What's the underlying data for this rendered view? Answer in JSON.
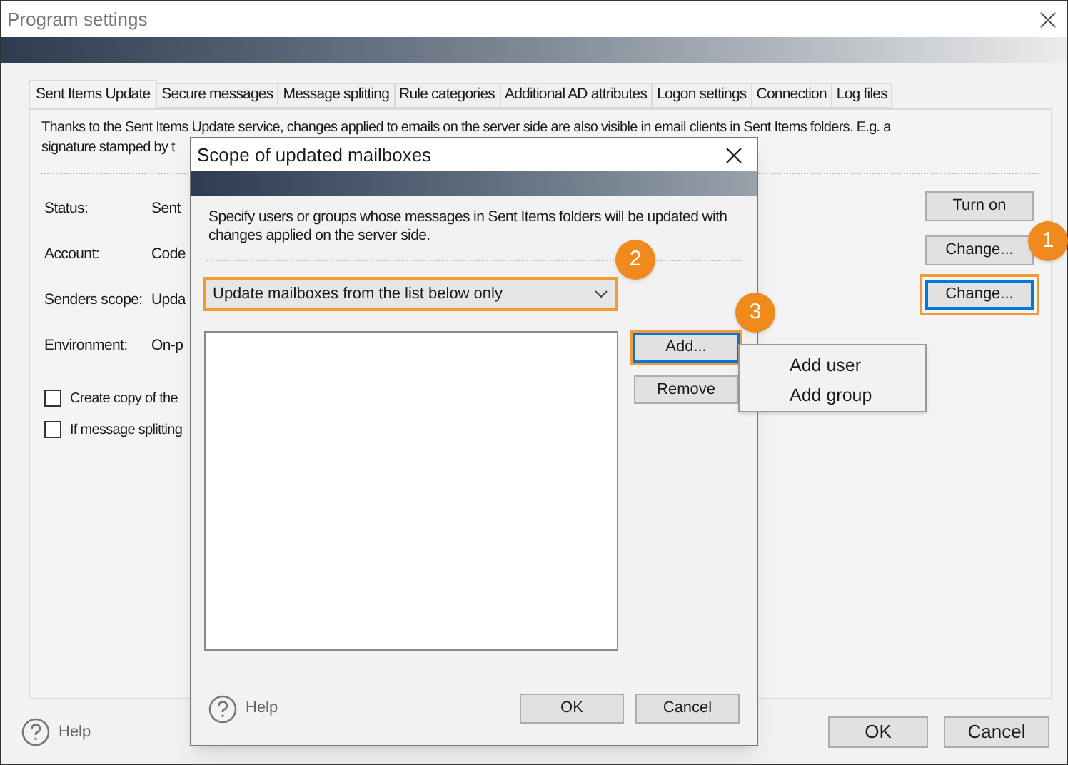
{
  "window": {
    "title": "Program settings"
  },
  "tabs": [
    {
      "label": "Sent Items Update",
      "selected": true
    },
    {
      "label": "Secure messages",
      "selected": false
    },
    {
      "label": "Message splitting",
      "selected": false
    },
    {
      "label": "Rule categories",
      "selected": false
    },
    {
      "label": "Additional AD attributes",
      "selected": false
    },
    {
      "label": "Logon settings",
      "selected": false
    },
    {
      "label": "Connection",
      "selected": false
    },
    {
      "label": "Log files",
      "selected": false
    }
  ],
  "description_lines": [
    "Thanks to the Sent Items Update service, changes applied to emails on the server side are also visible in email clients in Sent Items folders. E.g. a",
    "signature stamped by t"
  ],
  "fields": [
    {
      "label": "Status:",
      "value": "Sent"
    },
    {
      "label": "Account:",
      "value": "Code"
    },
    {
      "label": "Senders scope:",
      "value": "Upda"
    },
    {
      "label": "Environment:",
      "value": "On-p"
    }
  ],
  "checkboxes": [
    {
      "label": "Create copy of the",
      "checked": false
    },
    {
      "label": "If message splitting",
      "checked": false
    }
  ],
  "side_buttons": [
    {
      "label": "Turn on",
      "focused": false,
      "highlighted": false
    },
    {
      "label": "Change...",
      "focused": false,
      "highlighted": false
    },
    {
      "label": "Change...",
      "focused": true,
      "highlighted": true
    }
  ],
  "badges": [
    "1",
    "2",
    "3"
  ],
  "footer": {
    "help": "Help",
    "ok": "OK",
    "cancel": "Cancel"
  },
  "dialog": {
    "title": "Scope of updated mailboxes",
    "description": "Specify users or groups whose messages in Sent Items folders will be updated with changes applied on the server side.",
    "scope_dropdown": {
      "value": "Update mailboxes from the list below only",
      "highlighted": true
    },
    "add_button": {
      "label": "Add...",
      "focused": true,
      "highlighted": true
    },
    "remove_button": {
      "label": "Remove",
      "focused": false,
      "highlighted": false
    },
    "help": "Help",
    "ok": "OK",
    "cancel": "Cancel"
  },
  "add_menu": [
    "Add user",
    "Add group"
  ]
}
